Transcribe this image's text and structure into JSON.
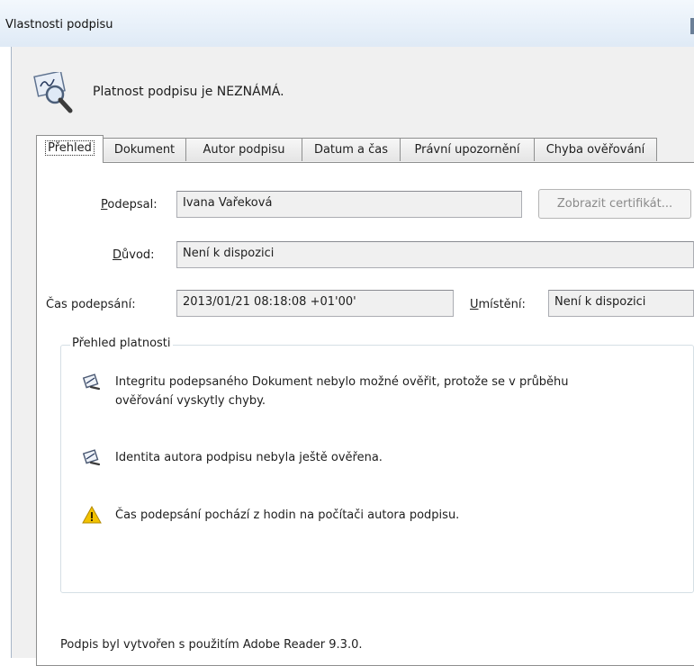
{
  "window": {
    "title": "Vlastnosti podpisu"
  },
  "banner": {
    "icon": "signature-magnifier-icon",
    "status_text": "Platnost podpisu je NEZNÁMÁ."
  },
  "tabs": [
    {
      "label": "Přehled",
      "active": true
    },
    {
      "label": "Dokument"
    },
    {
      "label": "Autor podpisu"
    },
    {
      "label": "Datum a čas"
    },
    {
      "label": "Právní upozornění"
    },
    {
      "label": "Chyba ověřování"
    }
  ],
  "fields": {
    "signer": {
      "label_prefix": "P",
      "label_rest": "odepsal:",
      "value": "Ivana Vařeková"
    },
    "reason": {
      "label_prefix": "D",
      "label_rest": "ůvod:",
      "value": "Není k dispozici"
    },
    "sign_time": {
      "label": "Čas podepsání:",
      "value": "2013/01/21 08:18:08 +01'00'"
    },
    "location": {
      "label_prefix": "U",
      "label_rest": "místění:",
      "value": "Není k dispozici"
    }
  },
  "buttons": {
    "show_certificate": "Zobrazit certifikát..."
  },
  "validity": {
    "legend": "Přehled platnosti",
    "items": [
      {
        "icon": "document-pen-icon",
        "line1": "Integritu podepsaného Dokument nebylo možné ověřit, protože se v průběhu",
        "line2": "ověřování vyskytly chyby."
      },
      {
        "icon": "document-pen-icon",
        "line1": "Identita autora podpisu nebyla ještě ověřena."
      },
      {
        "icon": "warning-icon",
        "line1": "Čas podepsání pochází z hodin na počítači autora podpisu."
      }
    ]
  },
  "footer": {
    "text": "Podpis byl vytvořen s použitím Adobe Reader 9.3.0."
  },
  "colors": {
    "window_bg": "#f0f0f0",
    "titlebar": "#dfeaf6",
    "field_bg": "#f0f0f0",
    "warning": "#f2c200",
    "disabled_text": "#8a8a8a"
  }
}
